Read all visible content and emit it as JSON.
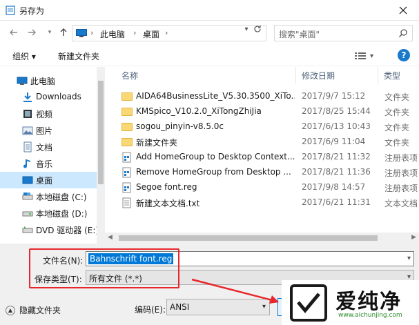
{
  "window": {
    "title": "另存为",
    "close_icon": "close-icon"
  },
  "navbar": {
    "back_icon": "arrow-left-icon",
    "forward_icon": "arrow-right-icon",
    "recent_icon": "chevron-down-icon",
    "up_icon": "arrow-up-icon",
    "breadcrumb": [
      "此电脑",
      "桌面"
    ],
    "search_placeholder": "搜索\"桌面\""
  },
  "toolbar": {
    "organize_label": "组织 ▾",
    "new_folder_label": "新建文件夹"
  },
  "nav_pane": {
    "items": [
      {
        "label": "此电脑",
        "icon": "computer-icon"
      },
      {
        "label": "Downloads",
        "icon": "downloads-icon"
      },
      {
        "label": "视频",
        "icon": "video-icon"
      },
      {
        "label": "图片",
        "icon": "pictures-icon"
      },
      {
        "label": "文档",
        "icon": "documents-icon"
      },
      {
        "label": "音乐",
        "icon": "music-icon"
      },
      {
        "label": "桌面",
        "icon": "desktop-icon",
        "selected": true
      },
      {
        "label": "本地磁盘 (C:)",
        "icon": "drive-icon"
      },
      {
        "label": "本地磁盘 (D:)",
        "icon": "drive-icon"
      },
      {
        "label": "DVD 驱动器 (E:)",
        "icon": "dvd-icon"
      }
    ]
  },
  "file_list": {
    "columns": [
      "名称",
      "修改日期",
      "类型"
    ],
    "rows": [
      {
        "name": "AIDA64BusinessLite_V5.30.3500_XiTo...",
        "date": "2017/9/7 15:12",
        "type": "文件夹",
        "icon": "folder-icon"
      },
      {
        "name": "KMSpico_V10.2.0_XiTongZhiJia",
        "date": "2017/8/25 15:44",
        "type": "文件夹",
        "icon": "folder-icon"
      },
      {
        "name": "sogou_pinyin-v8.5.0c",
        "date": "2017/6/13 10:43",
        "type": "文件夹",
        "icon": "folder-icon"
      },
      {
        "name": "新建文件夹",
        "date": "2017/6/9 11:04",
        "type": "文件夹",
        "icon": "folder-icon"
      },
      {
        "name": "Add HomeGroup to Desktop Context...",
        "date": "2017/8/21 11:32",
        "type": "注册表项",
        "icon": "registry-file-icon"
      },
      {
        "name": "Remove HomeGroup from Desktop ...",
        "date": "2017/8/21 11:36",
        "type": "注册表项",
        "icon": "registry-file-icon"
      },
      {
        "name": "Segoe font.reg",
        "date": "2017/9/8 14:57",
        "type": "注册表项",
        "icon": "registry-file-icon"
      },
      {
        "name": "新建文本文档.txt",
        "date": "2017/6/21 11:31",
        "type": "文本文档",
        "icon": "text-file-icon"
      }
    ]
  },
  "save_form": {
    "filename_label": "文件名(N):",
    "filename_value": "Bahnschrift font.reg",
    "filetype_label": "保存类型(T):",
    "filetype_value": "所有文件  (*.*)",
    "hide_folders_label": "隐藏文件夹",
    "encoding_label": "编码(E):",
    "encoding_value": "ANSI"
  },
  "watermark": {
    "text": "爱纯净",
    "url": "www.aichunjing.com"
  },
  "colors": {
    "selection": "#cce8ff",
    "accent": "#0078d7",
    "highlight_box": "#e8262b",
    "folder": "#f8d775"
  }
}
